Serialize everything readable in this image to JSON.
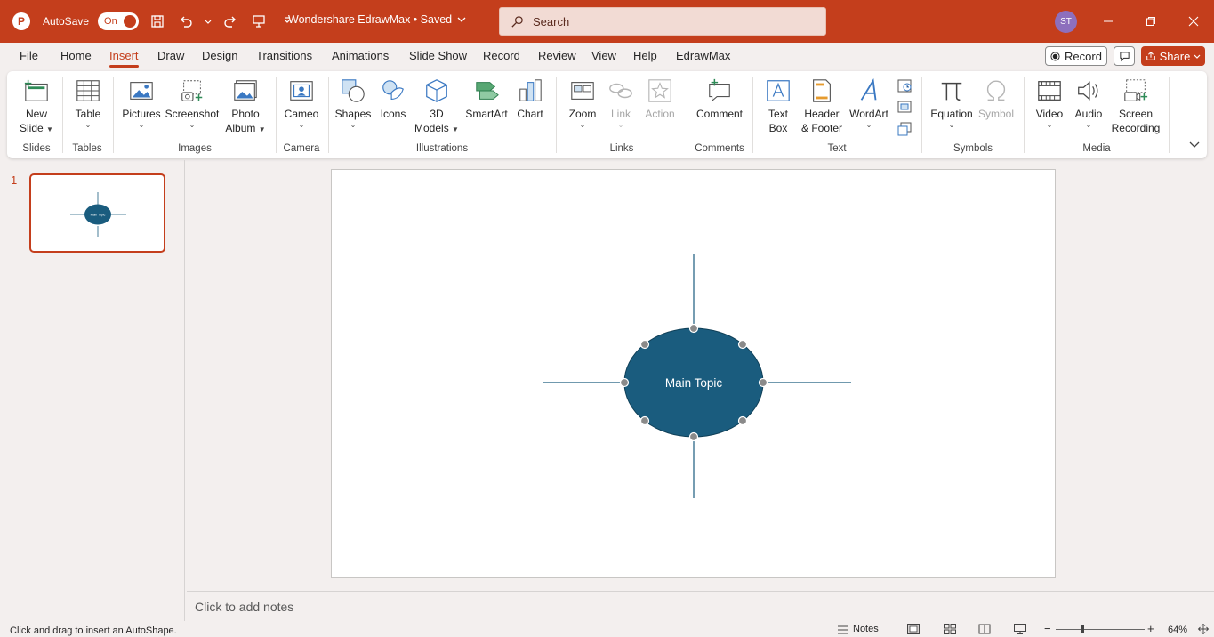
{
  "titlebar": {
    "autosave_label": "AutoSave",
    "autosave_state": "On",
    "doc_title": "Wondershare EdrawMax • Saved",
    "search_placeholder": "Search",
    "user_initials": "ST"
  },
  "menu": {
    "tabs": [
      "File",
      "Home",
      "Insert",
      "Draw",
      "Design",
      "Transitions",
      "Animations",
      "Slide Show",
      "Record",
      "Review",
      "View",
      "Help",
      "EdrawMax"
    ],
    "active_tab": "Insert",
    "record_label": "Record",
    "share_label": "Share"
  },
  "ribbon": {
    "buttons": {
      "new_slide": [
        "New",
        "Slide"
      ],
      "table": "Table",
      "pictures": "Pictures",
      "screenshot": "Screenshot",
      "photo_album": [
        "Photo",
        "Album"
      ],
      "cameo": "Cameo",
      "shapes": "Shapes",
      "icons": "Icons",
      "models_3d": [
        "3D",
        "Models"
      ],
      "smartart": "SmartArt",
      "chart": "Chart",
      "zoom": "Zoom",
      "link": "Link",
      "action": "Action",
      "comment": "Comment",
      "text_box": [
        "Text",
        "Box"
      ],
      "header_footer": [
        "Header",
        "& Footer"
      ],
      "wordart": "WordArt",
      "equation": "Equation",
      "symbol": "Symbol",
      "video": "Video",
      "audio": "Audio",
      "screen_recording": [
        "Screen",
        "Recording"
      ]
    },
    "groups": {
      "slides": "Slides",
      "tables": "Tables",
      "images": "Images",
      "camera": "Camera",
      "illustrations": "Illustrations",
      "links": "Links",
      "comments": "Comments",
      "text": "Text",
      "symbols": "Symbols",
      "media": "Media"
    }
  },
  "thumbnails": {
    "slide_number": "1",
    "thumb_text": "Main Topic"
  },
  "slide": {
    "main_topic": "Main Topic",
    "shape_fill": "#1a5c7e"
  },
  "notes": {
    "placeholder": "Click to add notes"
  },
  "status": {
    "message": "Click and drag to insert an AutoShape.",
    "notes_label": "Notes",
    "zoom_level": "64%"
  },
  "colors": {
    "accent": "#c43e1c"
  }
}
